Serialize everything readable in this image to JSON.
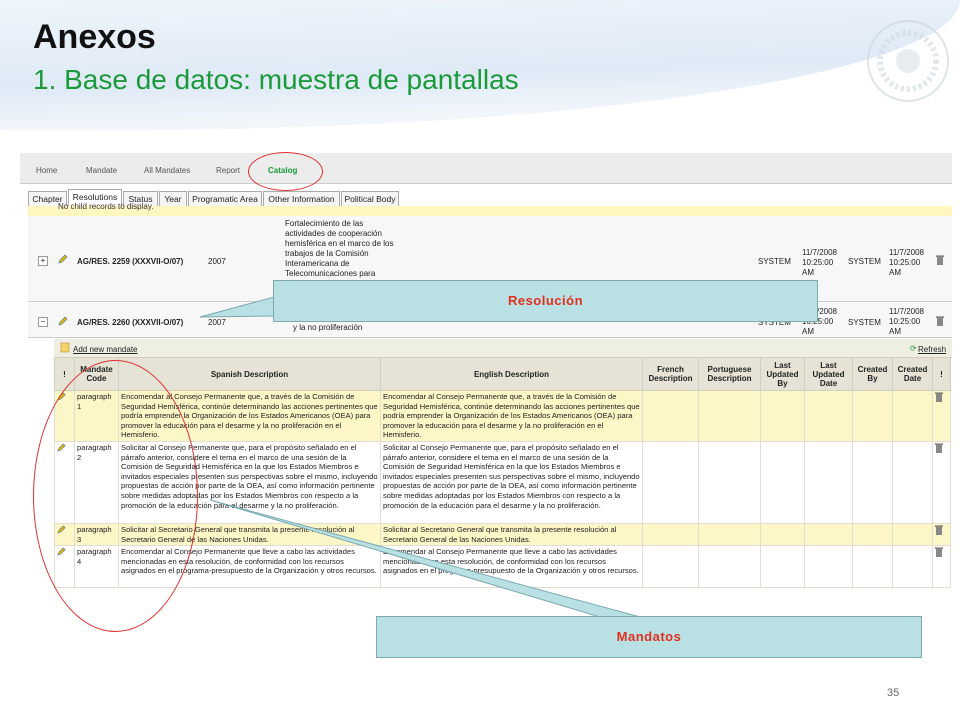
{
  "slide": {
    "title": "Anexos",
    "subtitle": "1. Base de datos: muestra de pantallas",
    "page_number": "35"
  },
  "nav": {
    "items": [
      "Home",
      "Mandate",
      "All Mandates",
      "Report",
      "Catalog"
    ]
  },
  "subtabs": [
    "Chapter",
    "Resolutions",
    "Status",
    "Year",
    "Programatic Area",
    "Other Information",
    "Political Body"
  ],
  "empty_message": "No child records to display.",
  "resolutions": [
    {
      "code": "AG/RES. 2259 (XXXVII-O/07)",
      "year": "2007",
      "description": "Fortalecimiento de las actividades de cooperación hemisférica en el marco de los trabajos de la Comisión Interamericana de Telecomunicaciones para",
      "updated_by": "SYSTEM",
      "updated_date": "11/7/2008 10:25:00 AM",
      "created_by": "SYSTEM",
      "created_date": "11/7/2008 10:25:00 AM"
    },
    {
      "code": "AG/RES. 2260 (XXXVII-O/07)",
      "year": "2007",
      "description": "y la no proliferación",
      "updated_by": "SYSTEM",
      "updated_date": "11/7/2008 10:25:00 AM",
      "created_by": "SYSTEM",
      "created_date": "11/7/2008 10:25:00 AM"
    }
  ],
  "mandates_toolbar": {
    "add_label": "Add new mandate",
    "refresh_label": "Refresh"
  },
  "mandates_table": {
    "headers": [
      "!",
      "Mandate Code",
      "Spanish Description",
      "English Description",
      "French Description",
      "Portuguese Description",
      "Last Updated By",
      "Last Updated Date",
      "Created By",
      "Created Date",
      "!"
    ],
    "rows": [
      {
        "code": "paragraph 1",
        "spanish": "Encomendar al Consejo Permanente que, a través de la Comisión de Seguridad Hemisférica, continúe determinando las acciones pertinentes que podría emprender la Organización de los Estados Americanos (OEA) para promover la educación para el desarme y la no proliferación en el Hemisferio.",
        "english": "Encomendar al Consejo Permanente que, a través de la Comisión de Seguridad Hemisférica, continúe determinando las acciones pertinentes que podría emprender la Organización de los Estados Americanos (OEA) para promover la educación para el desarme y la no proliferación en el Hemisferio."
      },
      {
        "code": "paragraph 2",
        "spanish": "Solicitar al Consejo Permanente que, para el propósito señalado en el párrafo anterior, considere el tema en el marco de una sesión de la Comisión de Seguridad Hemisférica en la que los Estados Miembros e invitados especiales presenten sus perspectivas sobre el mismo, incluyendo propuestas de acción por parte de la OEA, así como información pertinente sobre medidas adoptadas por los Estados Miembros con respecto a la promoción de la educación para el desarme y la no proliferación.",
        "english": "Solicitar al Consejo Permanente que, para el propósito señalado en el párrafo anterior, considere el tema en el marco de una sesión de la Comisión de Seguridad Hemisférica en la que los Estados Miembros e invitados especiales presenten sus perspectivas sobre el mismo, incluyendo propuestas de acción por parte de la OEA, así como información pertinente sobre medidas adoptadas por los Estados Miembros con respecto a la promoción de la educación para el desarme y la no proliferación."
      },
      {
        "code": "paragraph 3",
        "spanish": "Solicitar al Secretario General que transmita la presente resolución al Secretario General de las Naciones Unidas.",
        "english": "Solicitar al Secretario General que transmita la presente resolución al Secretario General de las Naciones Unidas."
      },
      {
        "code": "paragraph 4",
        "spanish": "Encomendar al Consejo Permanente que lleve a cabo las actividades mencionadas en esta resolución, de conformidad con los recursos asignados en el programa-presupuesto de la Organización y otros recursos.",
        "english": "Encomendar al Consejo Permanente que lleve a cabo las actividades mencionadas en esta resolución, de conformidad con los recursos asignados en el programa-presupuesto de la Organización y otros recursos."
      }
    ]
  },
  "callouts": {
    "resolucion": "Resolución",
    "mandatos": "Mandatos"
  },
  "colors": {
    "accent_green": "#1a9a3a",
    "callout_fill": "#b9e0e3",
    "callout_text": "#e03020",
    "highlight_row": "#fdf6c6",
    "oval": "#e03030"
  }
}
